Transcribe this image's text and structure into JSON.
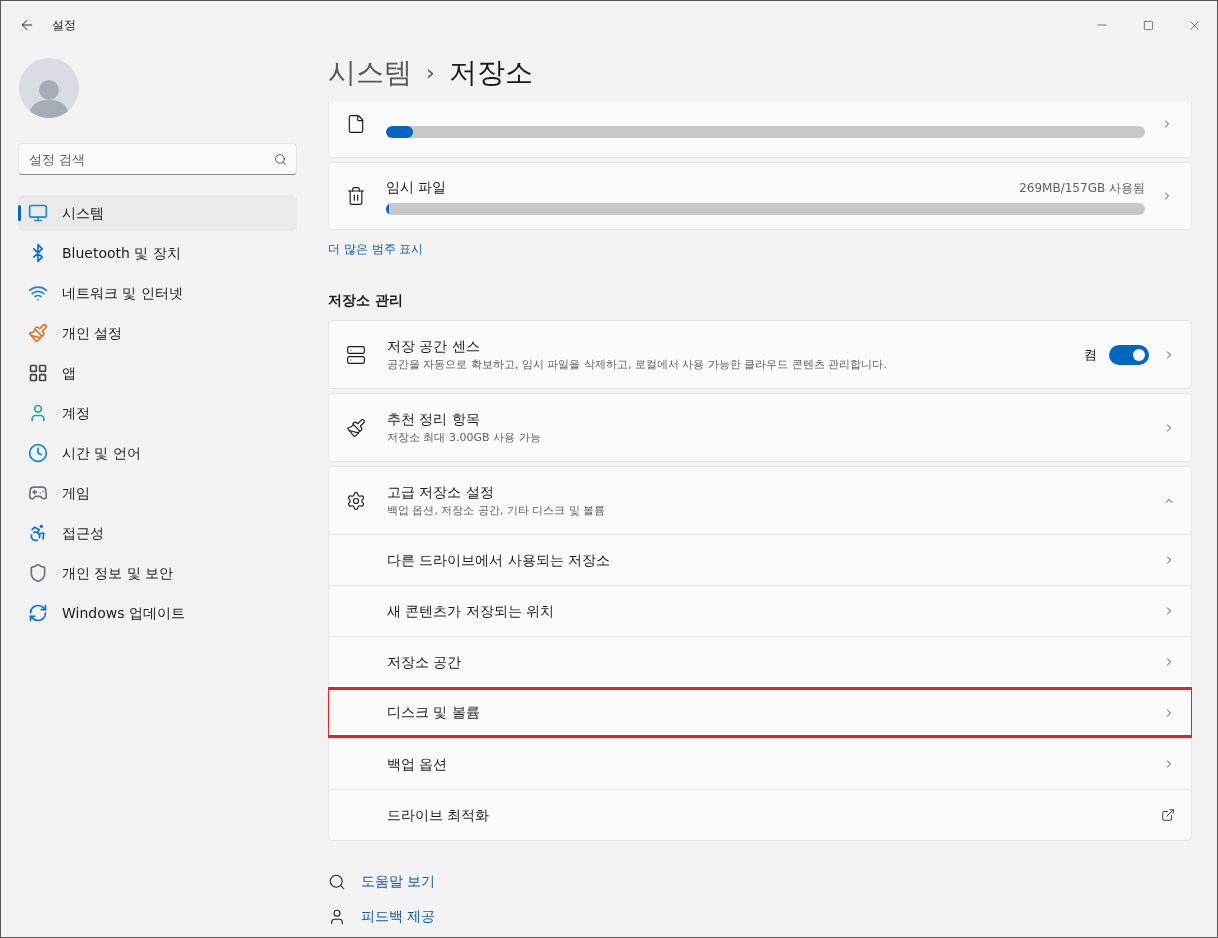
{
  "window": {
    "title": "설정"
  },
  "search": {
    "placeholder": "설정 검색"
  },
  "sidebar": {
    "items": [
      {
        "label": "시스템",
        "selected": true
      },
      {
        "label": "Bluetooth 및 장치",
        "selected": false
      },
      {
        "label": "네트워크 및 인터넷",
        "selected": false
      },
      {
        "label": "개인 설정",
        "selected": false
      },
      {
        "label": "앱",
        "selected": false
      },
      {
        "label": "계정",
        "selected": false
      },
      {
        "label": "시간 및 언어",
        "selected": false
      },
      {
        "label": "게임",
        "selected": false
      },
      {
        "label": "접근성",
        "selected": false
      },
      {
        "label": "개인 정보 및 보안",
        "selected": false
      },
      {
        "label": "Windows 업데이트",
        "selected": false
      }
    ]
  },
  "breadcrumb": {
    "parent": "시스템",
    "separator": "›",
    "current": "저장소"
  },
  "categories": [
    {
      "level": 0.035
    },
    {
      "title": "임시 파일",
      "usage": "269MB/157GB 사용됨",
      "level": 0.004
    }
  ],
  "more_link": "더 많은 범주 표시",
  "section_title": "저장소 관리",
  "cards": [
    {
      "kind": "toggle",
      "title": "저장 공간 센스",
      "subtitle": "공간을 자동으로 확보하고, 임시 파일을 삭제하고, 로컬에서 사용 가능한 클라우드 콘텐츠 관리합니다.",
      "toggle_label": "켬",
      "on": true
    },
    {
      "kind": "link",
      "title": "추천 정리 항목",
      "subtitle": "저장소 최대 3.00GB 사용 가능"
    },
    {
      "kind": "expander",
      "title": "고급 저장소 설정",
      "subtitle": "백업 옵션, 저장소 공간, 기타 디스크 및 볼륨",
      "expanded": true,
      "rows": [
        {
          "label": "다른 드라이브에서 사용되는 저장소",
          "kind": "chevron",
          "highlighted": false
        },
        {
          "label": "새 콘텐츠가 저장되는 위치",
          "kind": "chevron",
          "highlighted": false
        },
        {
          "label": "저장소 공간",
          "kind": "chevron",
          "highlighted": false
        },
        {
          "label": "디스크 및 볼륨",
          "kind": "chevron",
          "highlighted": true
        },
        {
          "label": "백업 옵션",
          "kind": "chevron",
          "highlighted": false
        },
        {
          "label": "드라이브 최적화",
          "kind": "external",
          "highlighted": false
        }
      ]
    }
  ],
  "footer_links": [
    {
      "label": "도움말 보기"
    },
    {
      "label": "피드백 제공"
    }
  ]
}
